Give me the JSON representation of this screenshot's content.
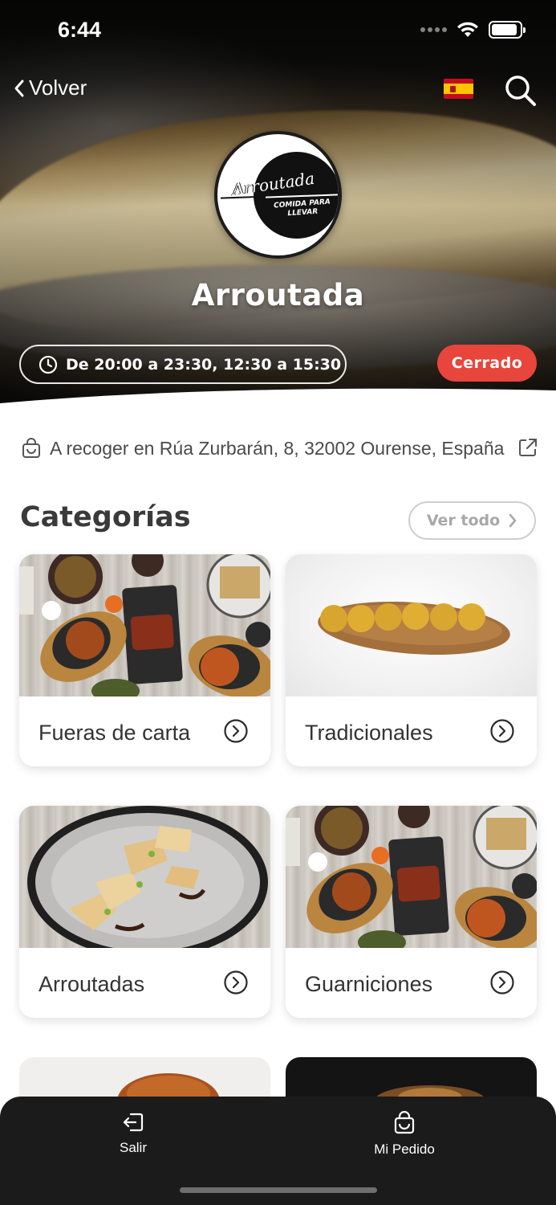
{
  "status_bar": {
    "time": "6:44",
    "battery_level": 0.9
  },
  "nav": {
    "back_label": "Volver",
    "language_flag": "spain-flag-icon"
  },
  "restaurant": {
    "logo_script": "Arroutada",
    "logo_subtitle": "COMIDA PARA LLEVAR",
    "name": "Arroutada",
    "hours": "De 20:00 a 23:30, 12:30 a 15:30",
    "status": "Cerrado",
    "pickup": "A recoger en Rúa Zurbarán, 8, 32002 Ourense, España"
  },
  "categories": {
    "title": "Categorías",
    "see_all_label": "Ver todo",
    "items": [
      {
        "label": "Fueras de carta"
      },
      {
        "label": "Tradicionales"
      },
      {
        "label": "Arroutadas"
      },
      {
        "label": "Guarniciones"
      }
    ]
  },
  "bottom_nav": {
    "items": [
      {
        "label": "Salir",
        "icon": "logout-icon"
      },
      {
        "label": "Mi Pedido",
        "icon": "bag-icon"
      }
    ]
  },
  "colors": {
    "status_closed": "#e8453c",
    "bottom_bar": "#1b1b1b",
    "text_dark": "#333333"
  }
}
